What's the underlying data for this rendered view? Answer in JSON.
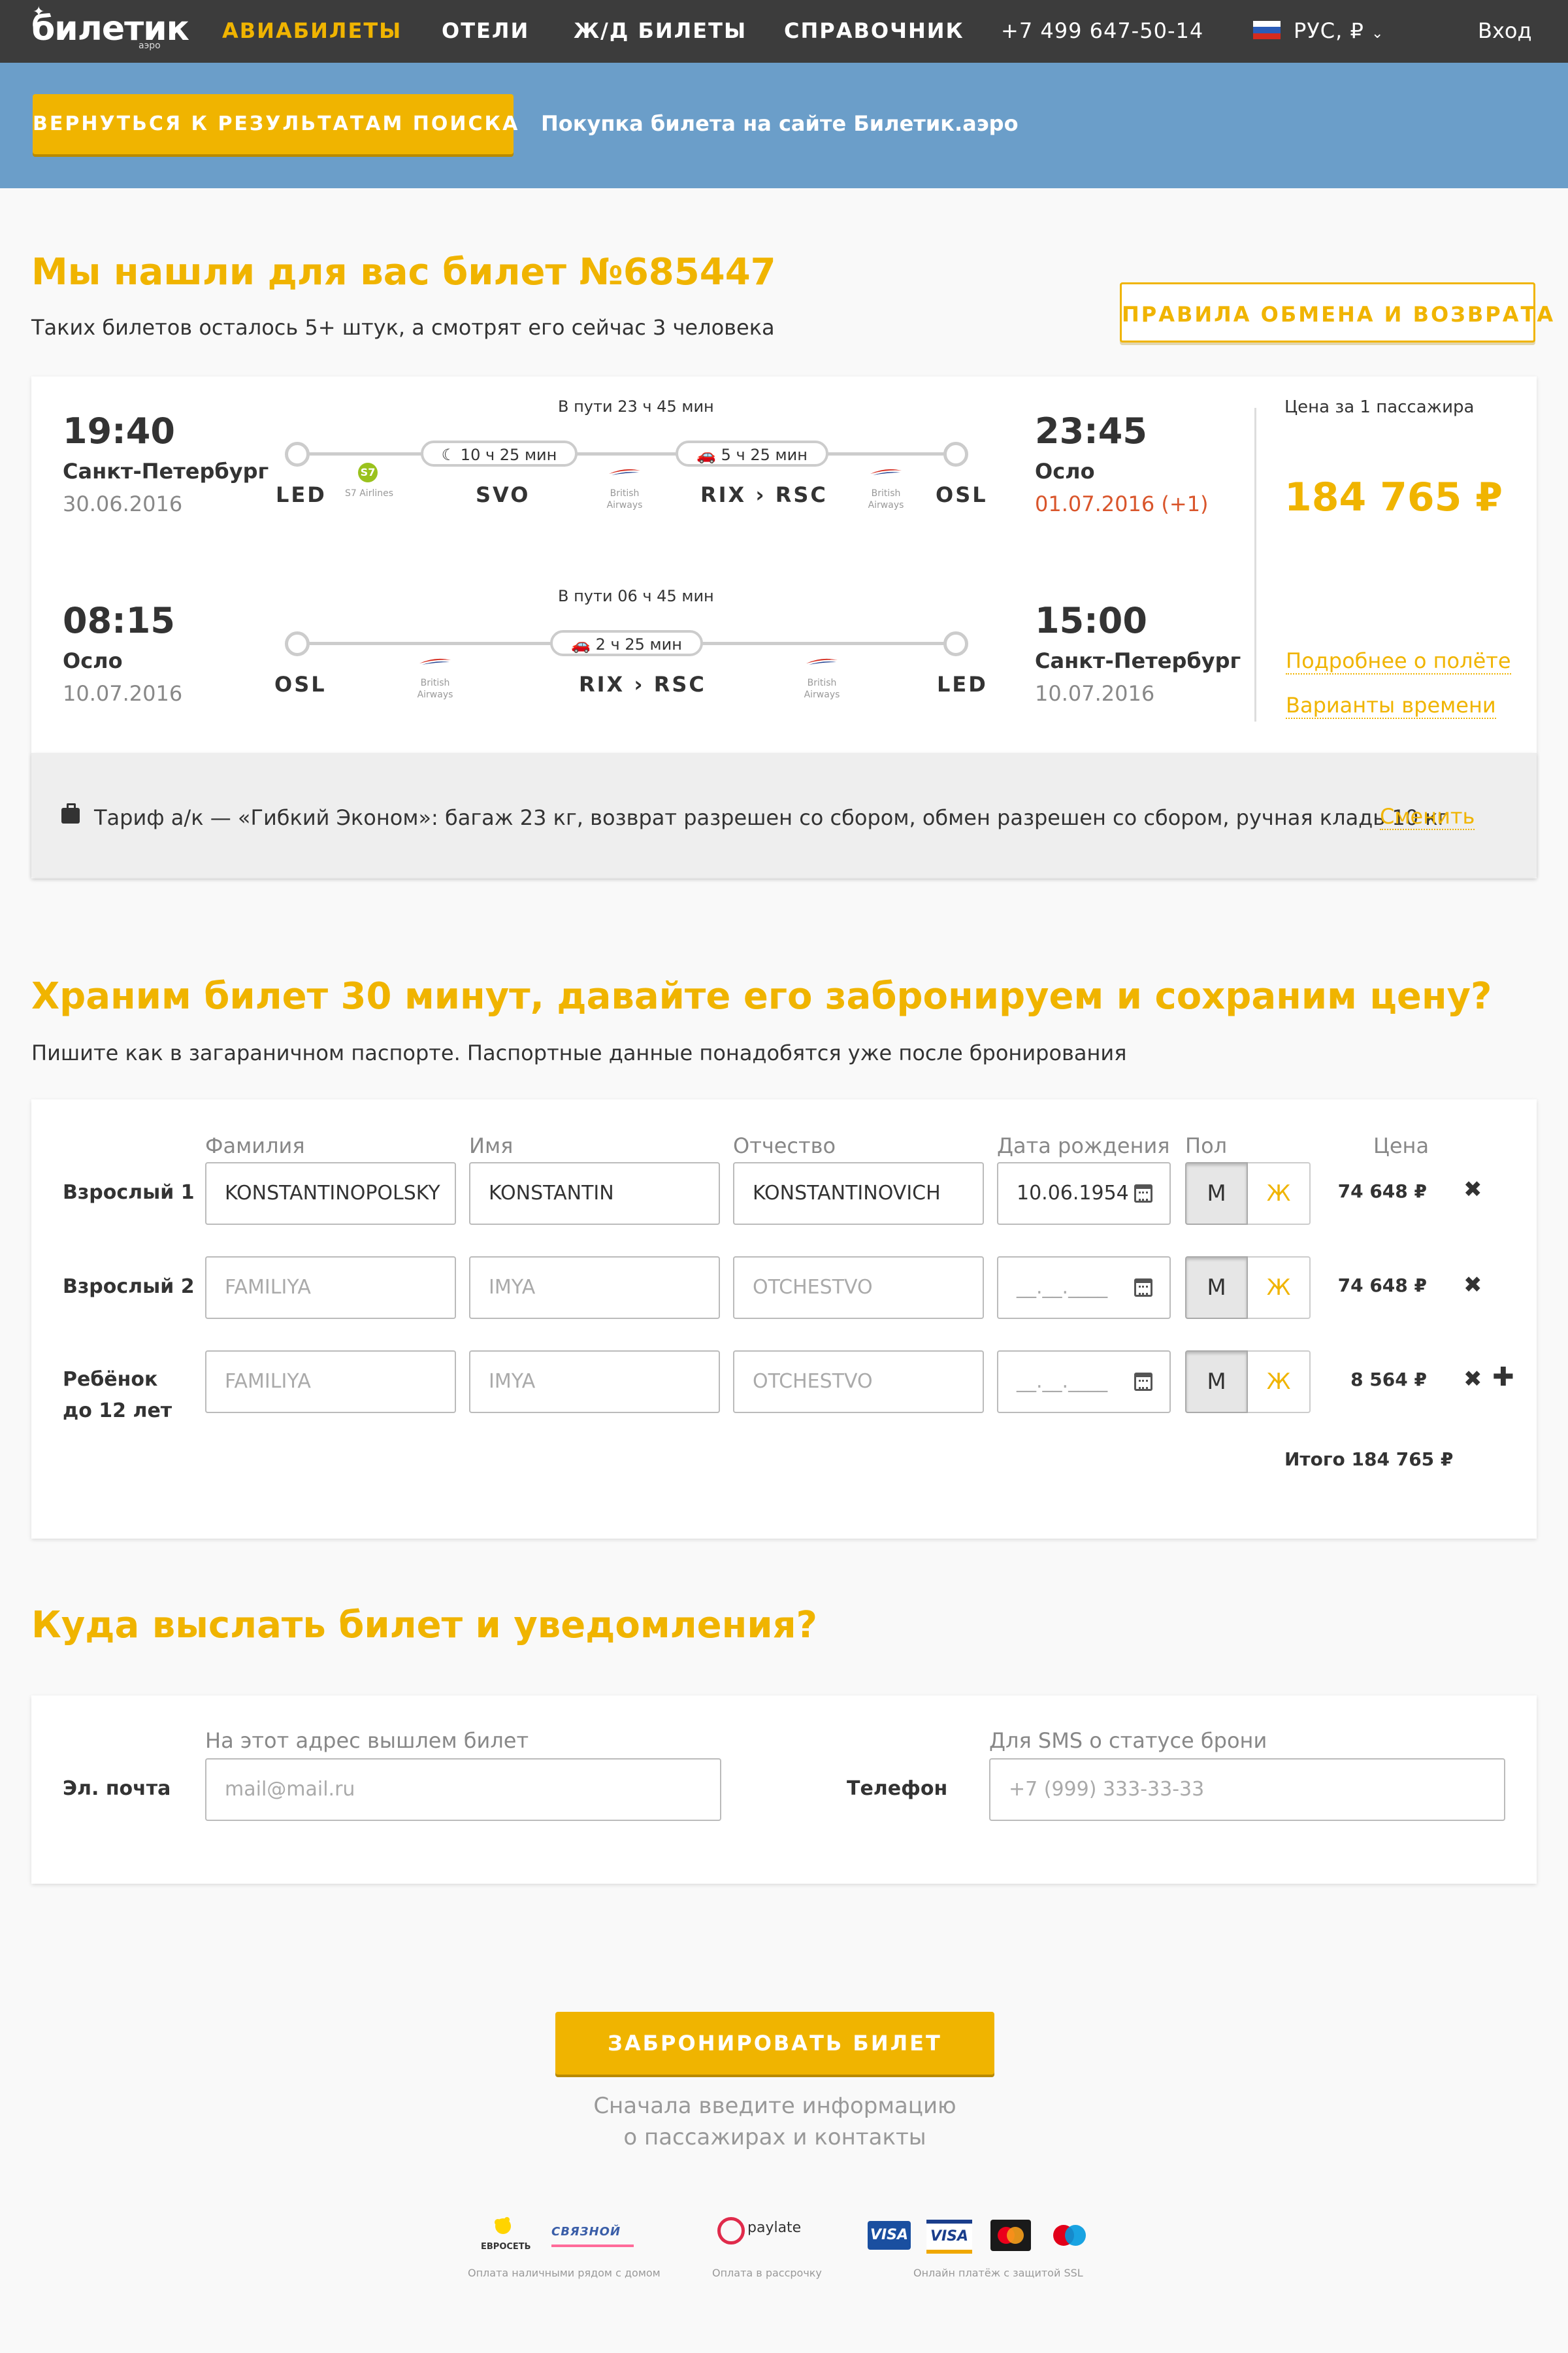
{
  "nav": {
    "logo": "билетик",
    "logo_sub": "аэро",
    "items": [
      "АВИАБИЛЕТЫ",
      "ОТЕЛИ",
      "Ж/Д БИЛЕТЫ",
      "СПРАВОЧНИК"
    ],
    "phone": "+7 499 647-50-14",
    "lang": "РУС, ₽",
    "login": "Вход"
  },
  "bluebar": {
    "back_button": "ВЕРНУТЬСЯ К РЕЗУЛЬТАТАМ ПОИСКА",
    "text": "Покупка билета на сайте Билетик.аэро"
  },
  "ticket": {
    "title": "Мы нашли для вас билет №685447",
    "subtitle": "Таких билетов осталось 5+ штук, а смотрят его сейчас 3 человека",
    "rules_button": "ПРАВИЛА ОБМЕНА И ВОЗВРАТА",
    "outbound": {
      "dep_time": "19:40",
      "dep_city": "Санкт-Петербург",
      "dep_date": "30.06.2016",
      "arr_time": "23:45",
      "arr_city": "Осло",
      "arr_date": "01.07.2016 (+1)",
      "travel_time": "В пути 23 ч 45 мин",
      "codes": [
        "LED",
        "SVO",
        "RIX › RSC",
        "OSL"
      ],
      "layovers": [
        "10 ч 25 мин",
        "5 ч 25 мин"
      ],
      "airlines": [
        "S7 Airlines",
        "British Airways",
        "British Airways"
      ],
      "s7_badge": "S7"
    },
    "inbound": {
      "dep_time": "08:15",
      "dep_city": "Осло",
      "dep_date": "10.07.2016",
      "arr_time": "15:00",
      "arr_city": "Санкт-Петербург",
      "arr_date": "10.07.2016",
      "travel_time": "В пути 06 ч 45 мин",
      "codes": [
        "OSL",
        "RIX › RSC",
        "LED"
      ],
      "layovers": [
        "2 ч 25 мин"
      ],
      "airlines": [
        "British Airways",
        "British Airways"
      ]
    },
    "price_caption": "Цена за 1 пассажира",
    "price": "184 765 ₽",
    "link_details": "Подробнее о полёте",
    "link_times": "Варианты времени",
    "tariff": "Тариф а/к — «Гибкий Эконом»: багаж 23 кг, возврат разрешен со сбором, обмен разрешен со сбором, ручная кладь 10 кг",
    "tariff_change": "Сменить"
  },
  "passengers": {
    "title": "Храним билет 30 минут, давайте его забронируем и сохраним цену?",
    "subtitle": "Пишите как в загараничном паспорте. Паспортные данные понадобятся уже после бронирования",
    "headers": {
      "surname": "Фамилия",
      "name": "Имя",
      "patronymic": "Отчество",
      "birth": "Дата рождения",
      "sex": "Пол",
      "price": "Цена"
    },
    "rows": [
      {
        "label": "Взрослый 1",
        "label2": "",
        "surname": "KONSTANTINOPOLSKY",
        "name": "KONSTANTIN",
        "patronymic": "KONSTANTINOVICH",
        "birth": "10.06.1954",
        "price": "74 648 ₽"
      },
      {
        "label": "Взрослый 2",
        "label2": "",
        "surname": "",
        "name": "",
        "patronymic": "",
        "birth": "",
        "price": "74 648 ₽"
      },
      {
        "label": "Ребёнок",
        "label2": "до 12 лет",
        "surname": "",
        "name": "",
        "patronymic": "",
        "birth": "",
        "price": "8 564 ₽"
      }
    ],
    "placeholders": {
      "surname": "FAMILIYA",
      "name": "IMYA",
      "patronymic": "OTCHESTVO",
      "birth": "__.__.____"
    },
    "sex_m": "М",
    "sex_f": "Ж",
    "total": "Итого 184 765 ₽"
  },
  "contacts": {
    "title": "Куда выслать билет и уведомления?",
    "email_caption": "На этот адрес вышлем билет",
    "email_label": "Эл. почта",
    "email_placeholder": "mail@mail.ru",
    "phone_caption": "Для SMS о статусе брони",
    "phone_label": "Телефон",
    "phone_placeholder": "+7 (999) 333-33-33"
  },
  "booking": {
    "button": "ЗАБРОНИРОВАТЬ БИЛЕТ",
    "note_line1": "Сначала введите информацию",
    "note_line2": "о пассажирах и контакты"
  },
  "payments": {
    "cash_caption": "Оплата наличными рядом с домом",
    "installment_caption": "Оплата в рассрочку",
    "online_caption": "Онлайн платёж с защитой SSL",
    "evroset": "ЕВРОСЕТЬ",
    "svyaznoy": "СВЯЗНОЙ",
    "paylate": "paylate",
    "visa1": "VISA",
    "visa2": "VISA"
  }
}
